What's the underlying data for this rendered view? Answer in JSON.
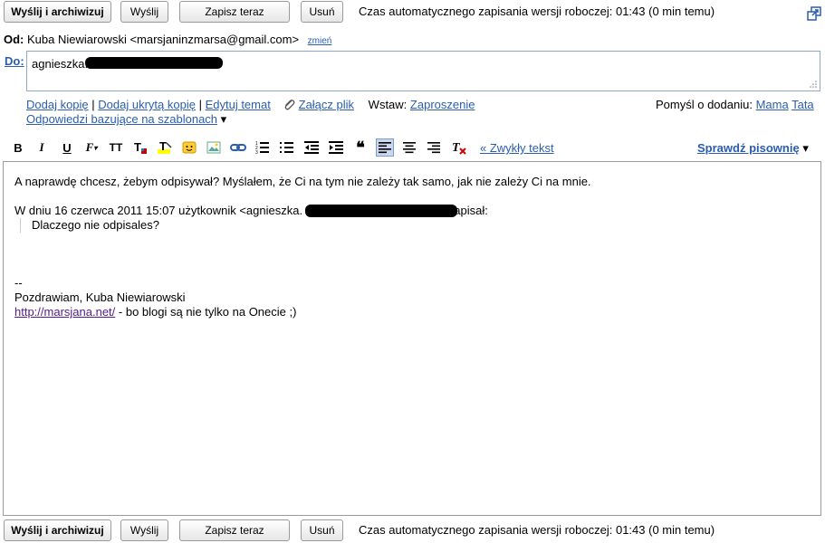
{
  "toolbar_buttons": {
    "send_archive": "Wyślij i archiwizuj",
    "send": "Wyślij",
    "save_now": "Zapisz teraz",
    "discard": "Usuń",
    "autosave": "Czas automatycznego zapisania wersji roboczej: 01:43 (0 min temu)"
  },
  "from": {
    "label": "Od:",
    "value": "Kuba Niewiarowski <marsjaninzmarsa@gmail.com>",
    "change": "zmień"
  },
  "to": {
    "label": "Do:",
    "value": "agnieszka."
  },
  "compose_links": {
    "add_cc": "Dodaj kopię",
    "add_bcc": "Dodaj ukrytą kopię",
    "edit_subject": "Edytuj temat",
    "attach": "Załącz plik",
    "insert_label": "Wstaw:",
    "invitation": "Zaproszenie",
    "canned": "Odpowiedzi bazujące na szablonach",
    "suggest_label": "Pomyśl o dodaniu:",
    "suggest_1": "Mama",
    "suggest_2": "Tata"
  },
  "format_toolbar": {
    "plain_text": "« Zwykły tekst",
    "spellcheck": "Sprawdź pisownię"
  },
  "body": {
    "line1": "A naprawdę chcesz, żebym odpisywał? Myślałem, że Ci na tym nie zależy tak samo, jak nie zależy Ci na mnie.",
    "quote_header_start": "W dniu 16 czerwca 2011 15:07 użytkownik <agnieszka.",
    "quote_header_end": "napisał:",
    "quote_text": "Dlaczego nie odpisales?",
    "sig_dash": "--",
    "sig_name": "Pozdrawiam, Kuba Niewiarowski",
    "sig_link": "http://marsjana.net/",
    "sig_tail": " - bo blogi są nie tylko na Onecie ;)"
  }
}
